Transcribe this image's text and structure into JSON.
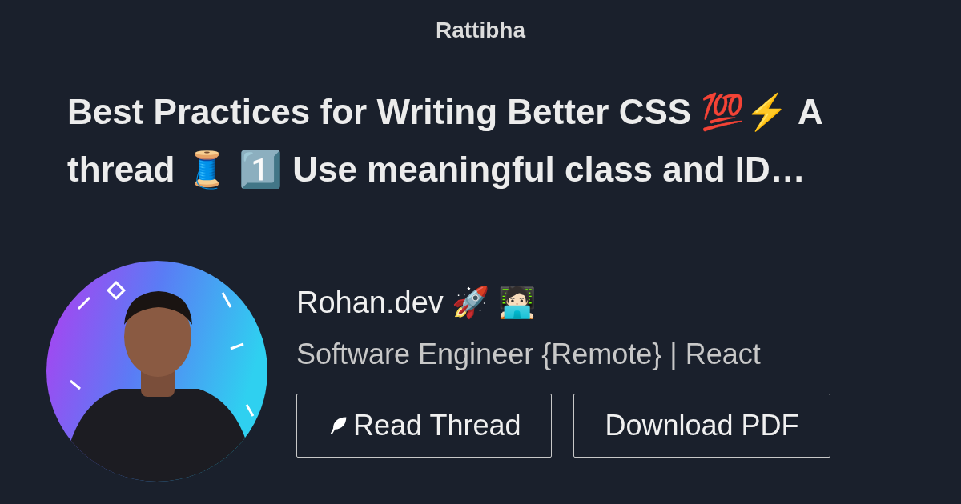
{
  "site": {
    "name": "Rattibha"
  },
  "headline": "Best Practices for Writing Better CSS 💯⚡ A thread 🧵 1️⃣ Use meaningful class and ID…",
  "author": {
    "name": "Rohan.dev 🚀 🧑🏻‍💻",
    "bio": "Software Engineer {Remote} | React"
  },
  "buttons": [
    {
      "label": "Read Thread",
      "kind": "feather"
    },
    {
      "label": "Download PDF",
      "kind": "plain"
    }
  ]
}
